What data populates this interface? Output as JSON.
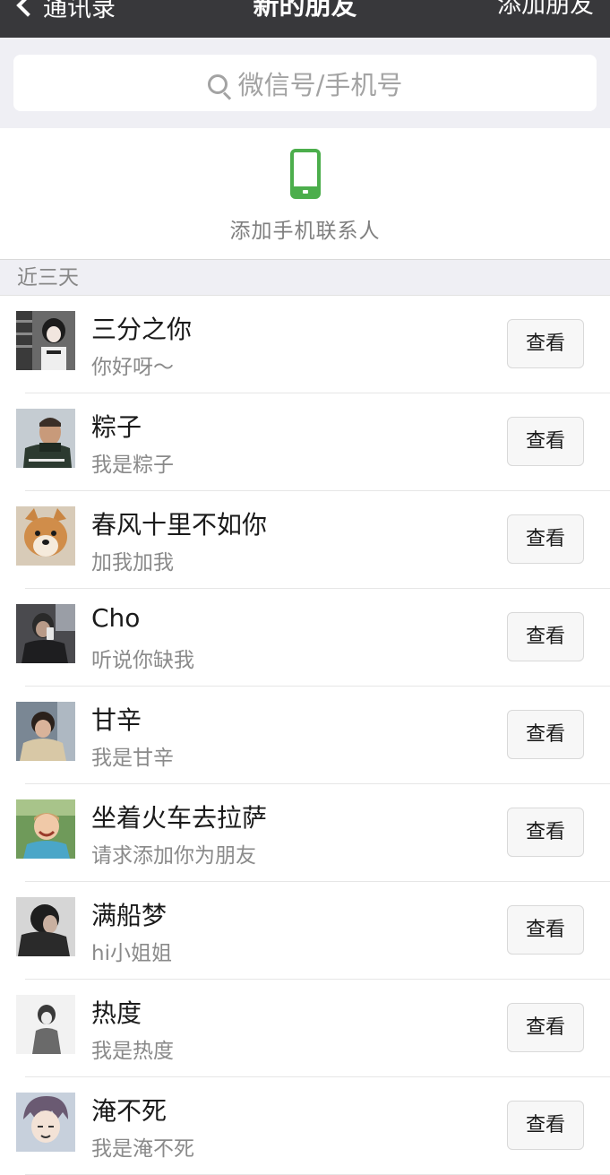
{
  "navbar": {
    "back_label": "通讯录",
    "title": "新的朋友",
    "right_label": "添加朋友"
  },
  "search": {
    "placeholder": "微信号/手机号"
  },
  "add_phone": {
    "label": "添加手机联系人",
    "icon": "mobile-phone-icon",
    "accent_color": "#4cae4c"
  },
  "section": {
    "title": "近三天"
  },
  "requests": [
    {
      "name": "三分之你",
      "message": "你好呀～",
      "action": "查看",
      "avatar": "anime-girl-avatar"
    },
    {
      "name": "粽子",
      "message": "我是粽子",
      "action": "查看",
      "avatar": "athlete-avatar"
    },
    {
      "name": "春风十里不如你",
      "message": "加我加我",
      "action": "查看",
      "avatar": "shiba-dog-avatar"
    },
    {
      "name": "Cho",
      "message": "听说你缺我",
      "action": "查看",
      "avatar": "mirror-selfie-avatar"
    },
    {
      "name": "甘辛",
      "message": "我是甘辛",
      "action": "查看",
      "avatar": "hoodie-boy-avatar"
    },
    {
      "name": "坐着火车去拉萨",
      "message": "请求添加你为朋友",
      "action": "查看",
      "avatar": "smiling-child-avatar"
    },
    {
      "name": "满船梦",
      "message": "hi小姐姐",
      "action": "查看",
      "avatar": "dark-portrait-avatar"
    },
    {
      "name": "热度",
      "message": "我是热度",
      "action": "查看",
      "avatar": "sketch-boy-avatar"
    },
    {
      "name": "淹不死",
      "message": "我是淹不死",
      "action": "查看",
      "avatar": "anime-boy-avatar"
    }
  ]
}
